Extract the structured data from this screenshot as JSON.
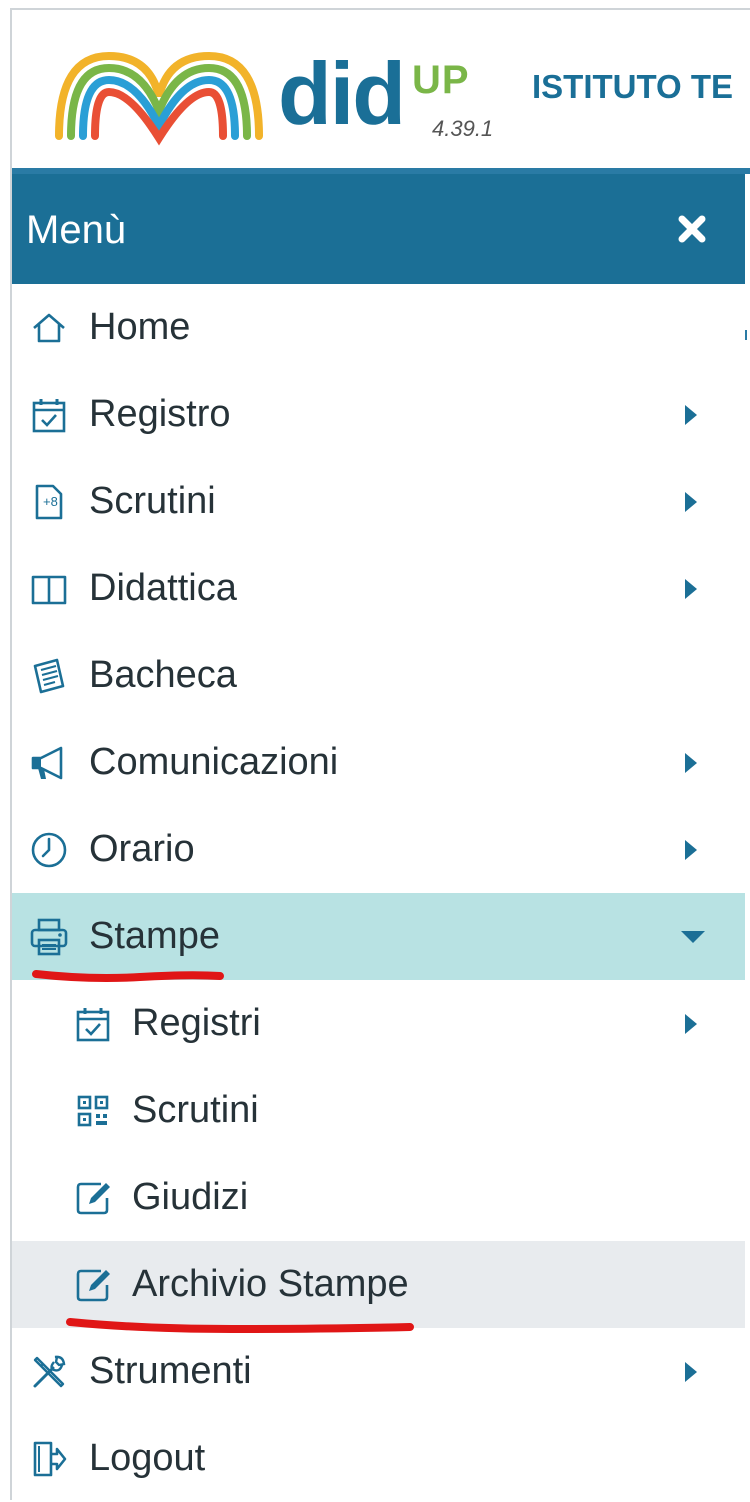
{
  "header": {
    "logo_word": "did",
    "logo_sup": "UP",
    "version": "4.39.1",
    "school_name": "ISTITUTO TE"
  },
  "menu": {
    "title": "Menù",
    "close_icon": "close-icon",
    "items": [
      {
        "label": "Home",
        "icon": "home-icon",
        "has_submenu": false
      },
      {
        "label": "Registro",
        "icon": "calendar-check-icon",
        "has_submenu": true
      },
      {
        "label": "Scrutini",
        "icon": "grade-report-icon",
        "has_submenu": true
      },
      {
        "label": "Didattica",
        "icon": "book-icon",
        "has_submenu": true
      },
      {
        "label": "Bacheca",
        "icon": "noticeboard-icon",
        "has_submenu": false
      },
      {
        "label": "Comunicazioni",
        "icon": "megaphone-icon",
        "has_submenu": true
      },
      {
        "label": "Orario",
        "icon": "clock-icon",
        "has_submenu": true
      },
      {
        "label": "Stampe",
        "icon": "printer-icon",
        "has_submenu": true,
        "expanded": true
      },
      {
        "label": "Registri",
        "icon": "calendar-check-icon",
        "has_submenu": true,
        "sub": true
      },
      {
        "label": "Scrutini",
        "icon": "qr-grid-icon",
        "has_submenu": false,
        "sub": true
      },
      {
        "label": "Giudizi",
        "icon": "edit-icon",
        "has_submenu": false,
        "sub": true
      },
      {
        "label": "Archivio Stampe",
        "icon": "edit-icon",
        "has_submenu": false,
        "sub": true,
        "hovered": true
      },
      {
        "label": "Strumenti",
        "icon": "tools-icon",
        "has_submenu": true
      },
      {
        "label": "Logout",
        "icon": "logout-icon",
        "has_submenu": false
      }
    ]
  },
  "colors": {
    "brand_blue": "#1b6f96",
    "active_bg": "#b8e2e3",
    "hover_bg": "#e8ebee",
    "annotation_red": "#e01616",
    "logo_green": "#7ab648"
  }
}
